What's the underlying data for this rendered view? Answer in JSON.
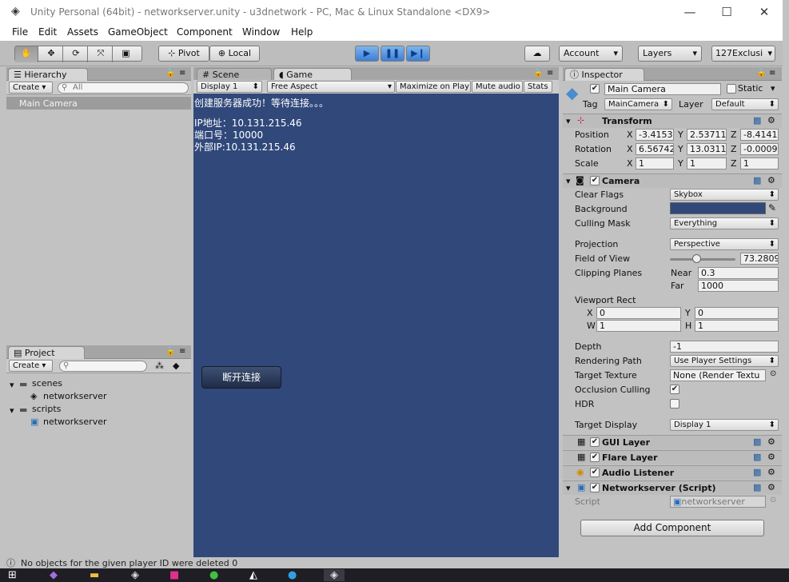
{
  "window": {
    "title": "Unity Personal (64bit) - networkserver.unity - u3dnetwork - PC, Mac & Linux Standalone <DX9>",
    "minimize": "—",
    "maximize": "☐",
    "close": "✕"
  },
  "menu": [
    "File",
    "Edit",
    "Assets",
    "GameObject",
    "Component",
    "Window",
    "Help"
  ],
  "toolbar": {
    "pivot": "Pivot",
    "local": "Local",
    "account": "Account",
    "layers": "Layers",
    "layout": "127Exclusi"
  },
  "hierarchy": {
    "tab": "Hierarchy",
    "create": "Create",
    "search_placeholder": "All",
    "items": [
      "Main Camera"
    ]
  },
  "project": {
    "tab": "Project",
    "create": "Create",
    "tree": [
      {
        "label": "scenes",
        "children": [
          "networkserver"
        ]
      },
      {
        "label": "scripts",
        "children": [
          "networkserver"
        ]
      }
    ]
  },
  "scene_tab": "Scene",
  "game": {
    "tab": "Game",
    "display": "Display 1",
    "aspect": "Free Aspect",
    "maximize": "Maximize on Play",
    "mute": "Mute audio",
    "stats": "Stats",
    "lines": [
      "创建服务器成功！等待连接。。。",
      "IP地址：10.131.215.46",
      "端口号：10000",
      "外部IP:10.131.215.46"
    ],
    "button": "断开连接",
    "background_color": "#30487a"
  },
  "inspector": {
    "tab": "Inspector",
    "object_name": "Main Camera",
    "static_label": "Static",
    "tag_label": "Tag",
    "tag_value": "MainCamera",
    "layer_label": "Layer",
    "layer_value": "Default",
    "transform": {
      "title": "Transform",
      "position_label": "Position",
      "position": [
        "-3.4153",
        "2.53711",
        "-8.4141"
      ],
      "rotation_label": "Rotation",
      "rotation": [
        "6.56742",
        "13.0311",
        "-0.0009"
      ],
      "scale_label": "Scale",
      "scale": [
        "1",
        "1",
        "1"
      ],
      "x": "X",
      "y": "Y",
      "z": "Z"
    },
    "camera": {
      "title": "Camera",
      "clear_flags_label": "Clear Flags",
      "clear_flags": "Skybox",
      "background_label": "Background",
      "culling_mask_label": "Culling Mask",
      "culling_mask": "Everything",
      "projection_label": "Projection",
      "projection": "Perspective",
      "fov_label": "Field of View",
      "fov": "73.2809",
      "clipping_label": "Clipping Planes",
      "near_label": "Near",
      "near": "0.3",
      "far_label": "Far",
      "far": "1000",
      "viewport_label": "Viewport Rect",
      "vx_label": "X",
      "vx": "0",
      "vy_label": "Y",
      "vy": "0",
      "vw_label": "W",
      "vw": "1",
      "vh_label": "H",
      "vh": "1",
      "depth_label": "Depth",
      "depth": "-1",
      "rendering_path_label": "Rendering Path",
      "rendering_path": "Use Player Settings",
      "target_texture_label": "Target Texture",
      "target_texture": "None (Render Textu",
      "occlusion_label": "Occlusion Culling",
      "hdr_label": "HDR",
      "target_display_label": "Target Display",
      "target_display": "Display 1"
    },
    "components": [
      "GUI Layer",
      "Flare Layer",
      "Audio Listener",
      "Networkserver (Script)"
    ],
    "script_label": "Script",
    "script_value": "networkserver",
    "add_component": "Add Component"
  },
  "status": "No objects for the given player ID were deleted 0"
}
